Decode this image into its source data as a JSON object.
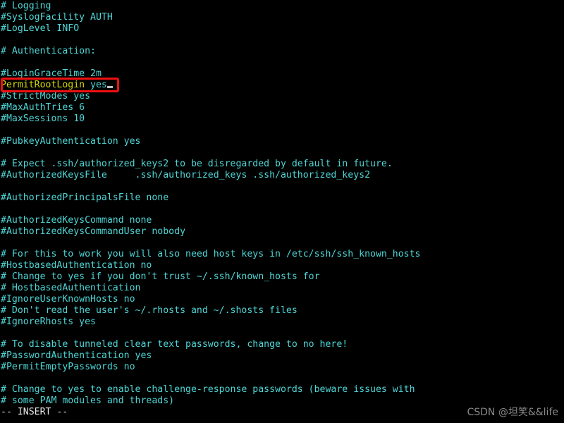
{
  "terminal": {
    "background_color": "#000000",
    "text_color": "#4fd6d6",
    "highlight_color": "#d7d700",
    "status_color": "#e8e8e8",
    "annotation_color": "#ee1111",
    "cursor_color": "#c0c0c0",
    "columns": 99,
    "rows": 37
  },
  "editor": {
    "mode_line": "-- INSERT --"
  },
  "annotation": {
    "label": "red-box-permitrootlogin",
    "target_line_index": 6,
    "color": "#ee1111"
  },
  "cursor": {
    "line_index": 6,
    "glyph": "_"
  },
  "watermark": {
    "text": "CSDN @坦笑&&life",
    "color": "#8a8a8a"
  },
  "lines": [
    {
      "i": 0,
      "text": "# Logging"
    },
    {
      "i": 1,
      "text": "#SyslogFacility AUTH"
    },
    {
      "i": 2,
      "text": "#LogLevel INFO"
    },
    {
      "i": 3,
      "text": ""
    },
    {
      "i": 4,
      "text": "# Authentication:"
    },
    {
      "i": 5,
      "text": ""
    },
    {
      "i": 6,
      "text": "#LoginGraceTime 2m"
    },
    {
      "i": 7,
      "text": "PermitRootLogin yes",
      "highlight": true,
      "key": "PermitRootLogin",
      "value": "yes"
    },
    {
      "i": 8,
      "text": "#StrictModes yes"
    },
    {
      "i": 9,
      "text": "#MaxAuthTries 6"
    },
    {
      "i": 10,
      "text": "#MaxSessions 10"
    },
    {
      "i": 11,
      "text": ""
    },
    {
      "i": 12,
      "text": "#PubkeyAuthentication yes"
    },
    {
      "i": 13,
      "text": ""
    },
    {
      "i": 14,
      "text": "# Expect .ssh/authorized_keys2 to be disregarded by default in future."
    },
    {
      "i": 15,
      "text": "#AuthorizedKeysFile     .ssh/authorized_keys .ssh/authorized_keys2"
    },
    {
      "i": 16,
      "text": ""
    },
    {
      "i": 17,
      "text": "#AuthorizedPrincipalsFile none"
    },
    {
      "i": 18,
      "text": ""
    },
    {
      "i": 19,
      "text": "#AuthorizedKeysCommand none"
    },
    {
      "i": 20,
      "text": "#AuthorizedKeysCommandUser nobody"
    },
    {
      "i": 21,
      "text": ""
    },
    {
      "i": 22,
      "text": "# For this to work you will also need host keys in /etc/ssh/ssh_known_hosts"
    },
    {
      "i": 23,
      "text": "#HostbasedAuthentication no"
    },
    {
      "i": 24,
      "text": "# Change to yes if you don't trust ~/.ssh/known_hosts for"
    },
    {
      "i": 25,
      "text": "# HostbasedAuthentication"
    },
    {
      "i": 26,
      "text": "#IgnoreUserKnownHosts no"
    },
    {
      "i": 27,
      "text": "# Don't read the user's ~/.rhosts and ~/.shosts files"
    },
    {
      "i": 28,
      "text": "#IgnoreRhosts yes"
    },
    {
      "i": 29,
      "text": ""
    },
    {
      "i": 30,
      "text": "# To disable tunneled clear text passwords, change to no here!"
    },
    {
      "i": 31,
      "text": "#PasswordAuthentication yes"
    },
    {
      "i": 32,
      "text": "#PermitEmptyPasswords no"
    },
    {
      "i": 33,
      "text": ""
    },
    {
      "i": 34,
      "text": "# Change to yes to enable challenge-response passwords (beware issues with"
    },
    {
      "i": 35,
      "text": "# some PAM modules and threads)"
    }
  ]
}
